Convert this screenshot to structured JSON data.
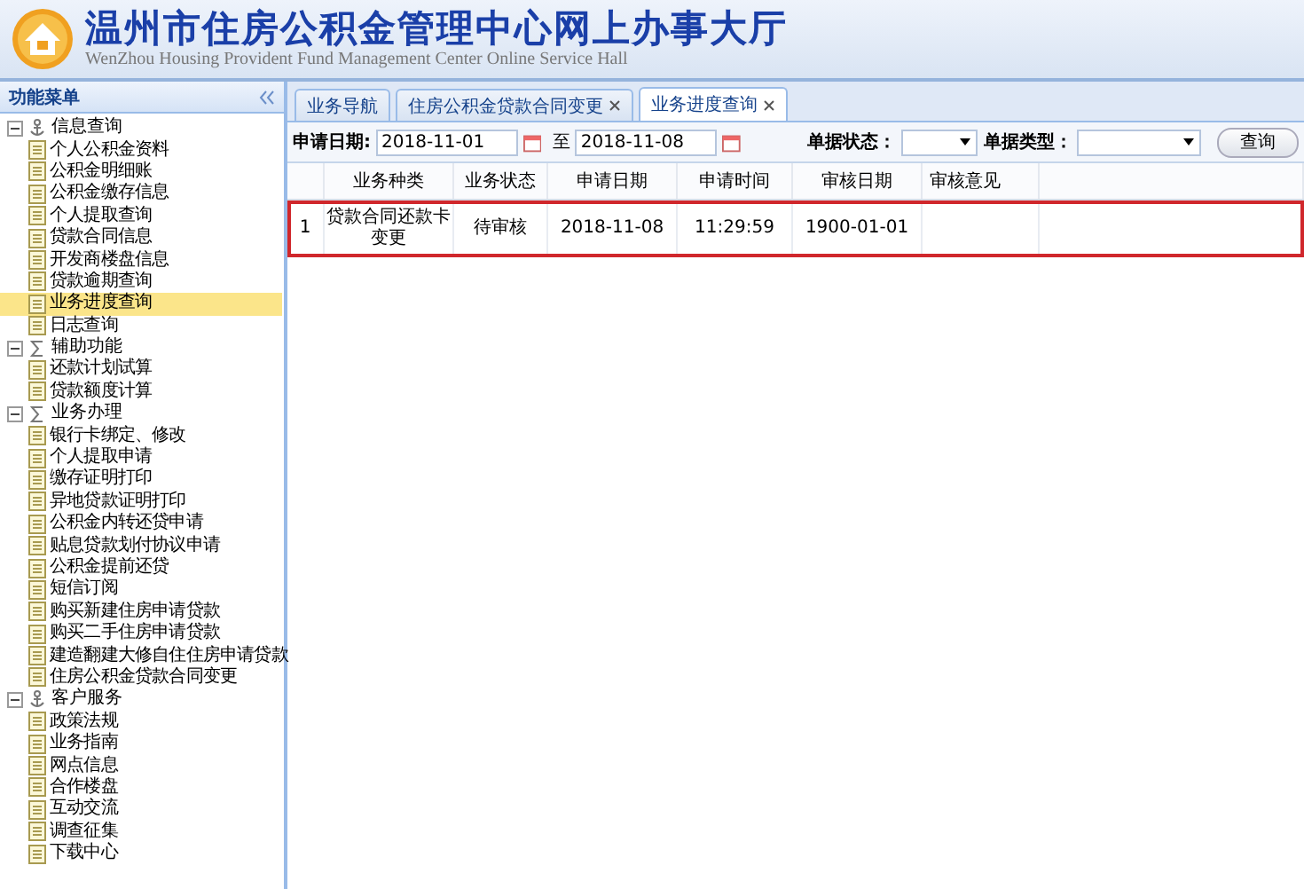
{
  "header": {
    "title": "温州市住房公积金管理中心网上办事大厅",
    "subtitle": "WenZhou Housing Provident Fund Management Center Online Service Hall"
  },
  "sidebar": {
    "title": "功能菜单",
    "groups": [
      {
        "label": "信息查询",
        "kind": "anchor",
        "expanded": true,
        "children": [
          {
            "label": "个人公积金资料",
            "selected": false
          },
          {
            "label": "公积金明细账",
            "selected": false
          },
          {
            "label": "公积金缴存信息",
            "selected": false
          },
          {
            "label": "个人提取查询",
            "selected": false
          },
          {
            "label": "贷款合同信息",
            "selected": false
          },
          {
            "label": "开发商楼盘信息",
            "selected": false
          },
          {
            "label": "贷款逾期查询",
            "selected": false
          },
          {
            "label": "业务进度查询",
            "selected": true
          },
          {
            "label": "日志查询",
            "selected": false
          }
        ]
      },
      {
        "label": "辅助功能",
        "kind": "sigma",
        "expanded": true,
        "children": [
          {
            "label": "还款计划试算",
            "selected": false
          },
          {
            "label": "贷款额度计算",
            "selected": false
          }
        ]
      },
      {
        "label": "业务办理",
        "kind": "sigma",
        "expanded": true,
        "children": [
          {
            "label": "银行卡绑定、修改",
            "selected": false
          },
          {
            "label": "个人提取申请",
            "selected": false
          },
          {
            "label": "缴存证明打印",
            "selected": false
          },
          {
            "label": "异地贷款证明打印",
            "selected": false
          },
          {
            "label": "公积金内转还贷申请",
            "selected": false
          },
          {
            "label": "贴息贷款划付协议申请",
            "selected": false
          },
          {
            "label": "公积金提前还贷",
            "selected": false
          },
          {
            "label": "短信订阅",
            "selected": false
          },
          {
            "label": "购买新建住房申请贷款",
            "selected": false
          },
          {
            "label": "购买二手住房申请贷款",
            "selected": false
          },
          {
            "label": "建造翻建大修自住住房申请贷款",
            "selected": false
          },
          {
            "label": "住房公积金贷款合同变更",
            "selected": false
          }
        ]
      },
      {
        "label": "客户服务",
        "kind": "anchor",
        "expanded": true,
        "children": [
          {
            "label": "政策法规",
            "selected": false
          },
          {
            "label": "业务指南",
            "selected": false
          },
          {
            "label": "网点信息",
            "selected": false
          },
          {
            "label": "合作楼盘",
            "selected": false
          },
          {
            "label": "互动交流",
            "selected": false
          },
          {
            "label": "调查征集",
            "selected": false
          },
          {
            "label": "下载中心",
            "selected": false
          }
        ]
      }
    ]
  },
  "tabs": [
    {
      "label": "业务导航",
      "closable": false,
      "selected": false
    },
    {
      "label": "住房公积金贷款合同变更",
      "closable": true,
      "selected": false
    },
    {
      "label": "业务进度查询",
      "closable": true,
      "selected": true
    }
  ],
  "filters": {
    "date_label": "申请日期:",
    "date_from": "2018-11-01",
    "date_sep": "至",
    "date_to": "2018-11-08",
    "status_label": "单据状态：",
    "type_label": "单据类型：",
    "search_button": "查询"
  },
  "table": {
    "columns": [
      "业务种类",
      "业务状态",
      "申请日期",
      "申请时间",
      "审核日期",
      "审核意见"
    ],
    "rows": [
      {
        "index": "1",
        "cells": [
          "贷款合同还款卡变更",
          "待审核",
          "2018-11-08",
          "11:29:59",
          "1900-01-01",
          ""
        ],
        "outlined": true
      }
    ]
  }
}
